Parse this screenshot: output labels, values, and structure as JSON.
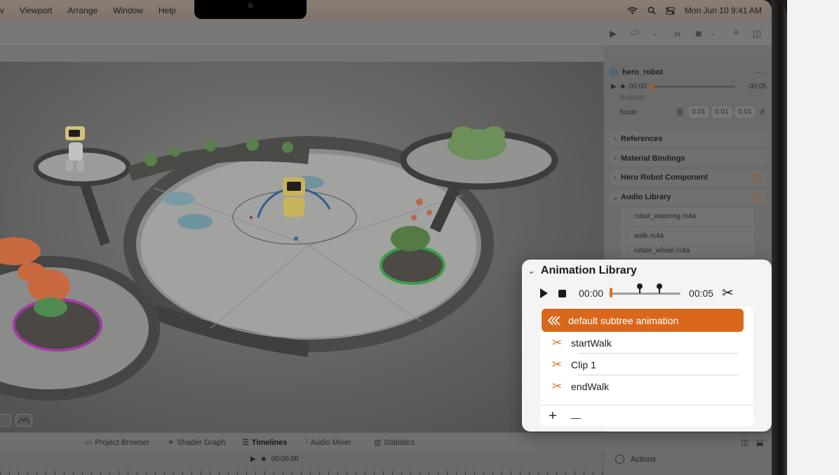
{
  "menubar": {
    "items": [
      "v",
      "Viewport",
      "Arrange",
      "Window",
      "Help"
    ],
    "datetime": "Mon Jun 10  9:41 AM"
  },
  "inspector": {
    "entity_name": "hero_robot",
    "transport": {
      "start": "00:00",
      "end": "00:05"
    },
    "rotation_label": "Rotation",
    "scale": {
      "label": "Scale",
      "x": "0.01",
      "y": "0.01",
      "z": "0.01"
    },
    "sections": [
      {
        "label": "References",
        "expanded": false,
        "badge": false
      },
      {
        "label": "Material Bindings",
        "expanded": false,
        "badge": false
      },
      {
        "label": "Hero Robot Component",
        "expanded": false,
        "badge": true
      },
      {
        "label": "Audio Library",
        "expanded": true,
        "badge": true
      }
    ],
    "audio_files": [
      "robot_watering.m4a",
      "walk.m4a",
      "rotate_wheel.m4a"
    ]
  },
  "bottom_tabs": [
    {
      "label": "Project Browser",
      "icon": "folder-icon",
      "active": false
    },
    {
      "label": "Shader Graph",
      "icon": "graph-icon",
      "active": false
    },
    {
      "label": "Timelines",
      "icon": "timeline-icon",
      "active": true
    },
    {
      "label": "Audio Mixer",
      "icon": "mixer-icon",
      "active": false
    },
    {
      "label": "Statistics",
      "icon": "stats-icon",
      "active": false
    }
  ],
  "timeline": {
    "time": "00:00.00"
  },
  "actions": {
    "label": "Actions"
  },
  "animation_library": {
    "title": "Animation Library",
    "start_time": "00:00",
    "end_time": "00:05",
    "playhead": 0.0,
    "marker_positions": [
      0.42,
      0.7
    ],
    "clips": [
      {
        "label": "default subtree animation",
        "icon": "subtree-animation-icon",
        "selected": true
      },
      {
        "label": "startWalk",
        "icon": "scissors-icon",
        "selected": false
      },
      {
        "label": "Clip 1",
        "icon": "scissors-icon",
        "selected": false
      },
      {
        "label": "endWalk",
        "icon": "scissors-icon",
        "selected": false
      }
    ],
    "add_symbol": "+",
    "remove_symbol": "—"
  },
  "colors": {
    "accent": "#d9681c",
    "accent_light": "#e0701f",
    "popover_bg": "#f4f4f5"
  }
}
